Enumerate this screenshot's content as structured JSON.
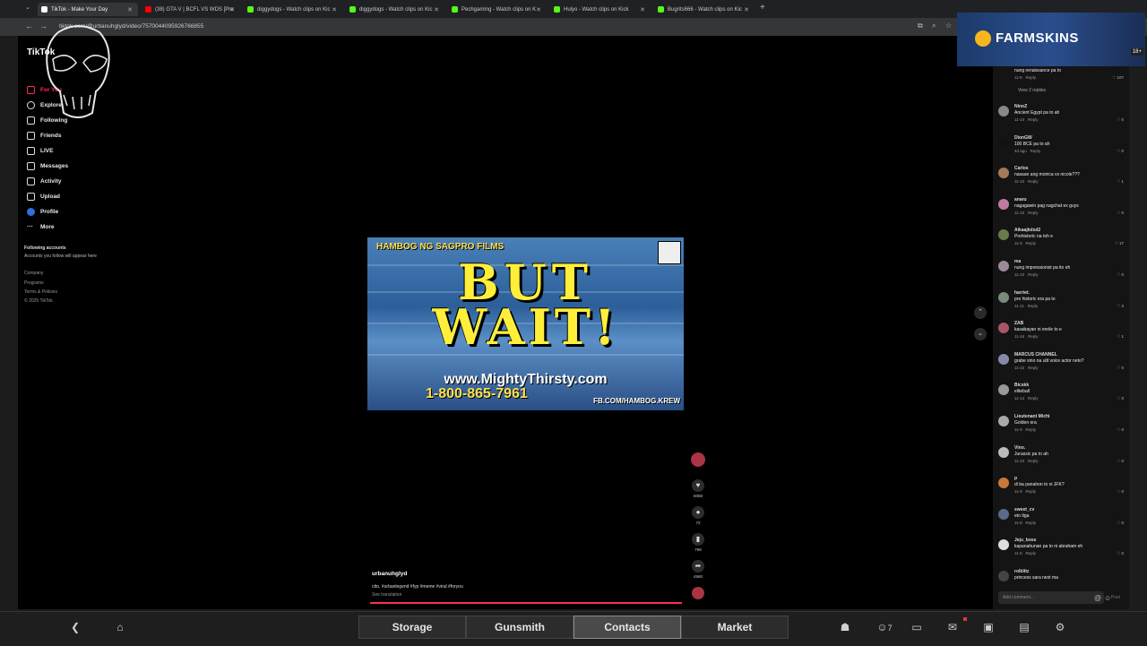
{
  "browser": {
    "tabs": [
      {
        "title": "TikTok - Make Your Day",
        "favicon_color": "#ffffff",
        "active": true
      },
      {
        "title": "(38) GTA V | BCFL VS WDS [Pre",
        "favicon_color": "#ff0000",
        "active": false
      },
      {
        "title": "diggydogs - Watch clips on Kic",
        "favicon_color": "#53fc18",
        "active": false
      },
      {
        "title": "diggydogs - Watch clips on Kic",
        "favicon_color": "#53fc18",
        "active": false
      },
      {
        "title": "Pechgaming - Watch clips on K",
        "favicon_color": "#53fc18",
        "active": false
      },
      {
        "title": "Hulyo - Watch clips on Kick",
        "favicon_color": "#53fc18",
        "active": false
      },
      {
        "title": "Bugrits666 - Watch clips on Kic",
        "favicon_color": "#53fc18",
        "active": false
      }
    ],
    "url": "tiktok.com/@urbanuhglyd/video/7570044095926766855",
    "back_icon": "arrow-left-icon",
    "forward_icon": "arrow-right-icon"
  },
  "tiktok": {
    "logo": "TikTok",
    "nav": [
      {
        "label": "For You",
        "icon": "home-icon"
      },
      {
        "label": "Explore",
        "icon": "compass-icon"
      },
      {
        "label": "Following",
        "icon": "user-icon"
      },
      {
        "label": "Friends",
        "icon": "users-icon"
      },
      {
        "label": "LIVE",
        "icon": "live-icon"
      },
      {
        "label": "Messages",
        "icon": "send-icon"
      },
      {
        "label": "Activity",
        "icon": "bell-icon"
      },
      {
        "label": "Upload",
        "icon": "plus-square-icon"
      },
      {
        "label": "Profile",
        "icon": "profile-icon"
      },
      {
        "label": "More",
        "icon": "dots-icon"
      }
    ],
    "following_title": "Following accounts",
    "following_hint": "Accounts you follow will appear here",
    "footer_links": [
      "Company",
      "Programs",
      "Terms & Policies",
      "© 2025 TikTok"
    ]
  },
  "video": {
    "top_left_text": "HAMBOG NG SAGPRO FILMS",
    "line1": "BUT",
    "line2": "WAIT!",
    "website": "www.MightyThirsty.com",
    "phone": "1-800-865-7961",
    "facebook": "FB.COM/HAMBOG.KREW",
    "channel": "urbanuhglyd",
    "tags": "ctto. #urbanlegend #fyp #meme #viral #foryou",
    "see_translation": "See translation",
    "actions": [
      {
        "icon": "heart-icon",
        "count": "6058"
      },
      {
        "icon": "comment-icon",
        "count": "72"
      },
      {
        "icon": "bookmark-icon",
        "count": "799"
      },
      {
        "icon": "share-icon",
        "count": "4560"
      }
    ]
  },
  "comments": {
    "items": [
      {
        "name": "",
        "text": "nung renaissance pa to",
        "date": "11-8",
        "likes": "107",
        "avatar": "#666666"
      },
      {
        "name": "",
        "text": "View 2 replies",
        "date": "",
        "likes": "",
        "avatar": ""
      },
      {
        "name": "NinoZ",
        "text": "Ancient Egypt pa to ah",
        "date": "11-10",
        "likes": "0",
        "avatar": "#888888"
      },
      {
        "name": "DionGW",
        "text": "100 BCE pa to ah",
        "date": "4d ago",
        "likes": "0",
        "avatar": "#111111"
      },
      {
        "name": "Carlos",
        "text": "nasaan ang monica vs nicole???",
        "date": "11-10",
        "likes": "1",
        "avatar": "#a57a5a"
      },
      {
        "name": "anaru",
        "text": "nagagawin pag nagchat ex guys",
        "date": "11-10",
        "likes": "0",
        "avatar": "#c07aa0"
      },
      {
        "name": "Aikaajkdsd2",
        "text": "Prehistoric na toh e",
        "date": "11-9",
        "likes": "17",
        "avatar": "#6a7a4a"
      },
      {
        "name": "ma",
        "text": "nung impressionist pa ito eh",
        "date": "11-10",
        "likes": "0",
        "avatar": "#9a8a9a"
      },
      {
        "name": "harriet.",
        "text": "pre historic era pa to",
        "date": "11-11",
        "likes": "3",
        "avatar": "#7a8a7a"
      },
      {
        "name": "ZAB",
        "text": "kasabayan ni enrile to e",
        "date": "11-16",
        "likes": "1",
        "avatar": "#aa5566"
      },
      {
        "name": "MARCUS CHANNEL",
        "text": "grabe sino na ulit voice actor neto?",
        "date": "11-22",
        "likes": "0",
        "avatar": "#8888aa"
      },
      {
        "name": "Bicskk",
        "text": "eliteball",
        "date": "11-14",
        "likes": "0",
        "avatar": "#999999"
      },
      {
        "name": "Lieutenant Michi",
        "text": "Golden era",
        "date": "11-9",
        "likes": "0",
        "avatar": "#aaaaaa"
      },
      {
        "name": "Vino.",
        "text": "Jurassic pa to ah",
        "date": "11-23",
        "likes": "0",
        "avatar": "#bbbbbb"
      },
      {
        "name": "p",
        "text": "di ba panahon to ni JFK?",
        "date": "11-9",
        "likes": "0",
        "avatar": "#c87a3a"
      },
      {
        "name": "sweet_cv",
        "text": "eto tlga",
        "date": "11-8",
        "likes": "0",
        "avatar": "#5a6a8a"
      },
      {
        "name": "Jeju_boss",
        "text": "kapanahunan pa to ni abraham eh",
        "date": "11-5",
        "likes": "0",
        "avatar": "#dddddd"
      },
      {
        "name": "rolblitz",
        "text": "princess sara next ma",
        "date": "",
        "likes": "",
        "avatar": "#444444"
      }
    ],
    "input_placeholder": "Add comment...",
    "post_label": "Post"
  },
  "banner": {
    "text": "FARMSKINS",
    "age": "18+"
  },
  "game_bar": {
    "buttons": [
      "Storage",
      "Gunsmith",
      "Contacts",
      "Market"
    ],
    "selected": "Contacts",
    "badge_count": "7",
    "left_icons": [
      "back-arrow-icon",
      "home-icon"
    ],
    "right_icons": [
      "group-icon",
      "friends-icon",
      "chat-icon",
      "mail-icon",
      "bag-icon",
      "notes-icon",
      "settings-icon"
    ]
  }
}
